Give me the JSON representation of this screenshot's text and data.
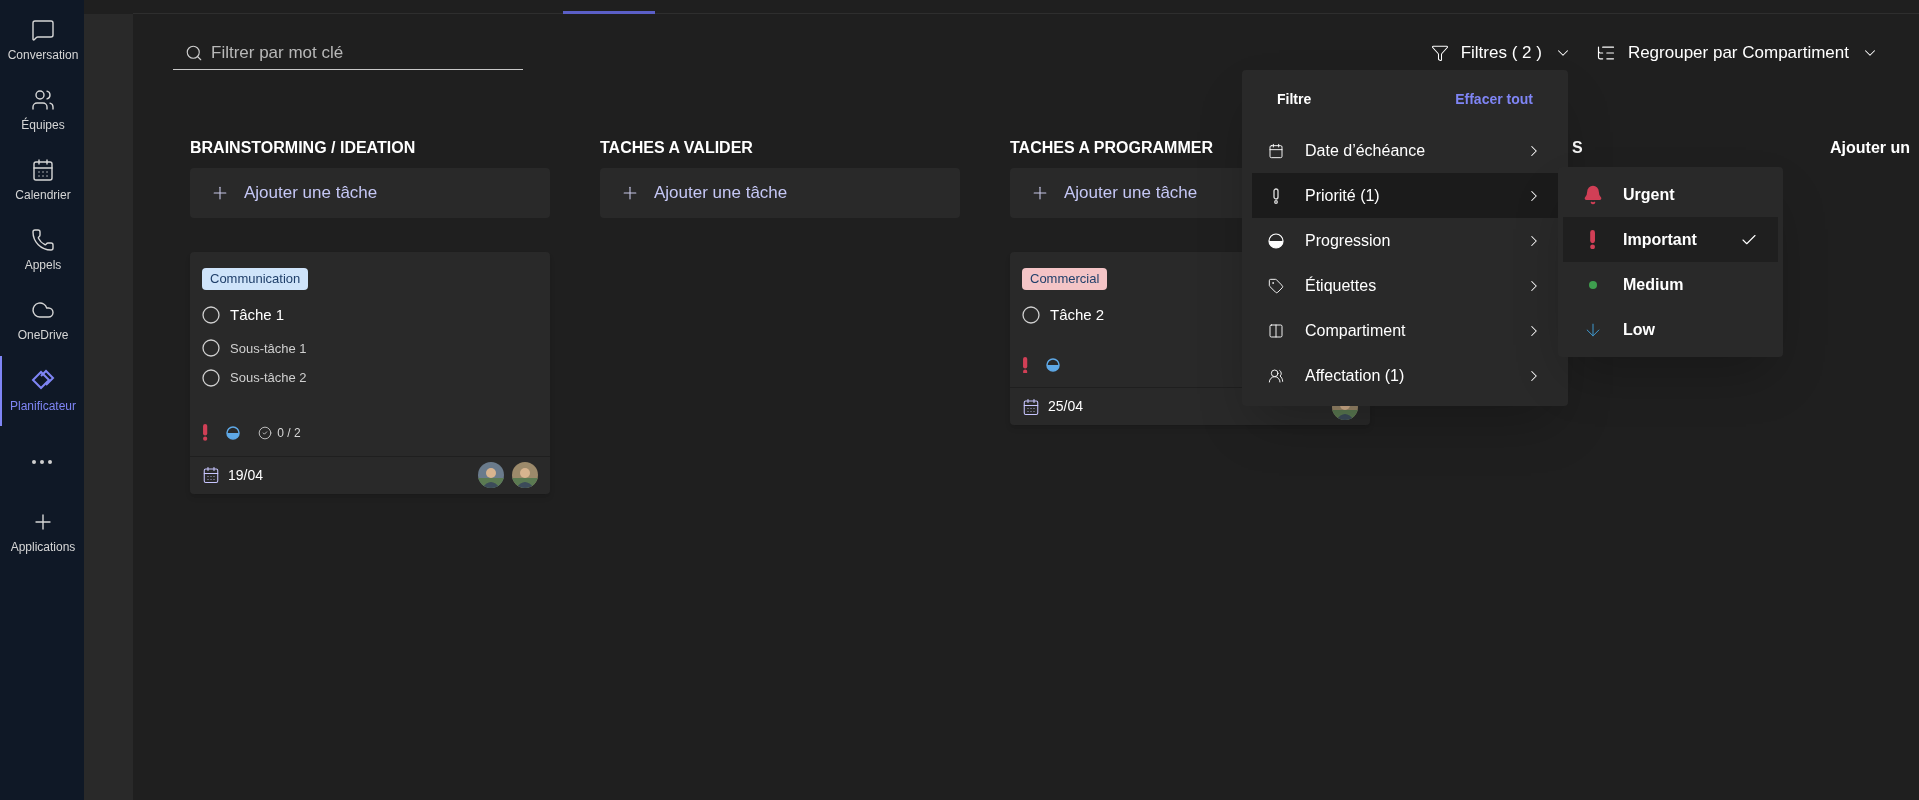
{
  "sidebar": {
    "items": [
      {
        "label": "Conversation",
        "kind": "chat",
        "selected": false
      },
      {
        "label": "Équipes",
        "kind": "teams",
        "selected": false
      },
      {
        "label": "Calendrier",
        "kind": "calendar",
        "selected": false
      },
      {
        "label": "Appels",
        "kind": "phone",
        "selected": false
      },
      {
        "label": "OneDrive",
        "kind": "cloud",
        "selected": false
      },
      {
        "label": "Planificateur",
        "kind": "planner",
        "selected": true
      },
      {
        "kind": "more",
        "selected": false
      },
      {
        "label": "Applications",
        "kind": "apps",
        "selected": false
      }
    ]
  },
  "toolbar": {
    "search": {
      "placeholder": "Filtrer par mot clé"
    },
    "filters": "Filtres ( 2 )",
    "group_by": "Regrouper par Compartiment"
  },
  "columns": [
    {
      "title": "BRAINSTORMING / IDEATION",
      "add_label": "Ajouter une tâche",
      "tasks": [
        {
          "tag": {
            "label": "Communication",
            "color": "#cfe4fa"
          },
          "title": "Tâche 1",
          "completed": false,
          "subtasks": [
            {
              "title": "Sous-tâche 1",
              "checked": false
            },
            {
              "title": "Sous-tâche 2",
              "checked": false
            }
          ],
          "priority": {
            "kind": "important"
          },
          "progress": {
            "kind": "in_progress"
          },
          "checklist": "0 / 2",
          "due": "19/04"
        }
      ]
    },
    {
      "title": "TACHES A VALIDER",
      "add_label": "Ajouter une tâche"
    },
    {
      "title": "TACHES A PROGRAMMER",
      "add_label": "Ajouter une tâche",
      "tasks": [
        {
          "tag": {
            "label": "Commercial",
            "color": "#f4c4c6"
          },
          "title": "Tâche 2",
          "completed": false,
          "priority": {
            "kind": "important"
          },
          "progress": {
            "kind": "in_progress"
          },
          "due": "25/04"
        }
      ]
    },
    {
      "title": "S"
    },
    {
      "title": "Ajouter un"
    }
  ],
  "filter_menu": {
    "title": "Filtre",
    "clear": "Effacer tout",
    "items": [
      {
        "label": "Date d’échéance",
        "kind": "date",
        "selected": false
      },
      {
        "label": "Priorité (1)",
        "kind": "priority",
        "selected": true
      },
      {
        "label": "Progression",
        "kind": "progress",
        "selected": false
      },
      {
        "label": "Étiquettes",
        "kind": "tag",
        "selected": false
      },
      {
        "label": "Compartiment",
        "kind": "bucket",
        "selected": false
      },
      {
        "label": "Affectation (1)",
        "kind": "people",
        "selected": false
      }
    ]
  },
  "priority_menu": {
    "items": [
      {
        "label": "Urgent",
        "kind": "urgent",
        "checked": false
      },
      {
        "label": "Important",
        "kind": "important",
        "checked": true
      },
      {
        "label": "Medium",
        "kind": "medium",
        "checked": false
      },
      {
        "label": "Low",
        "kind": "low",
        "checked": false
      }
    ]
  }
}
